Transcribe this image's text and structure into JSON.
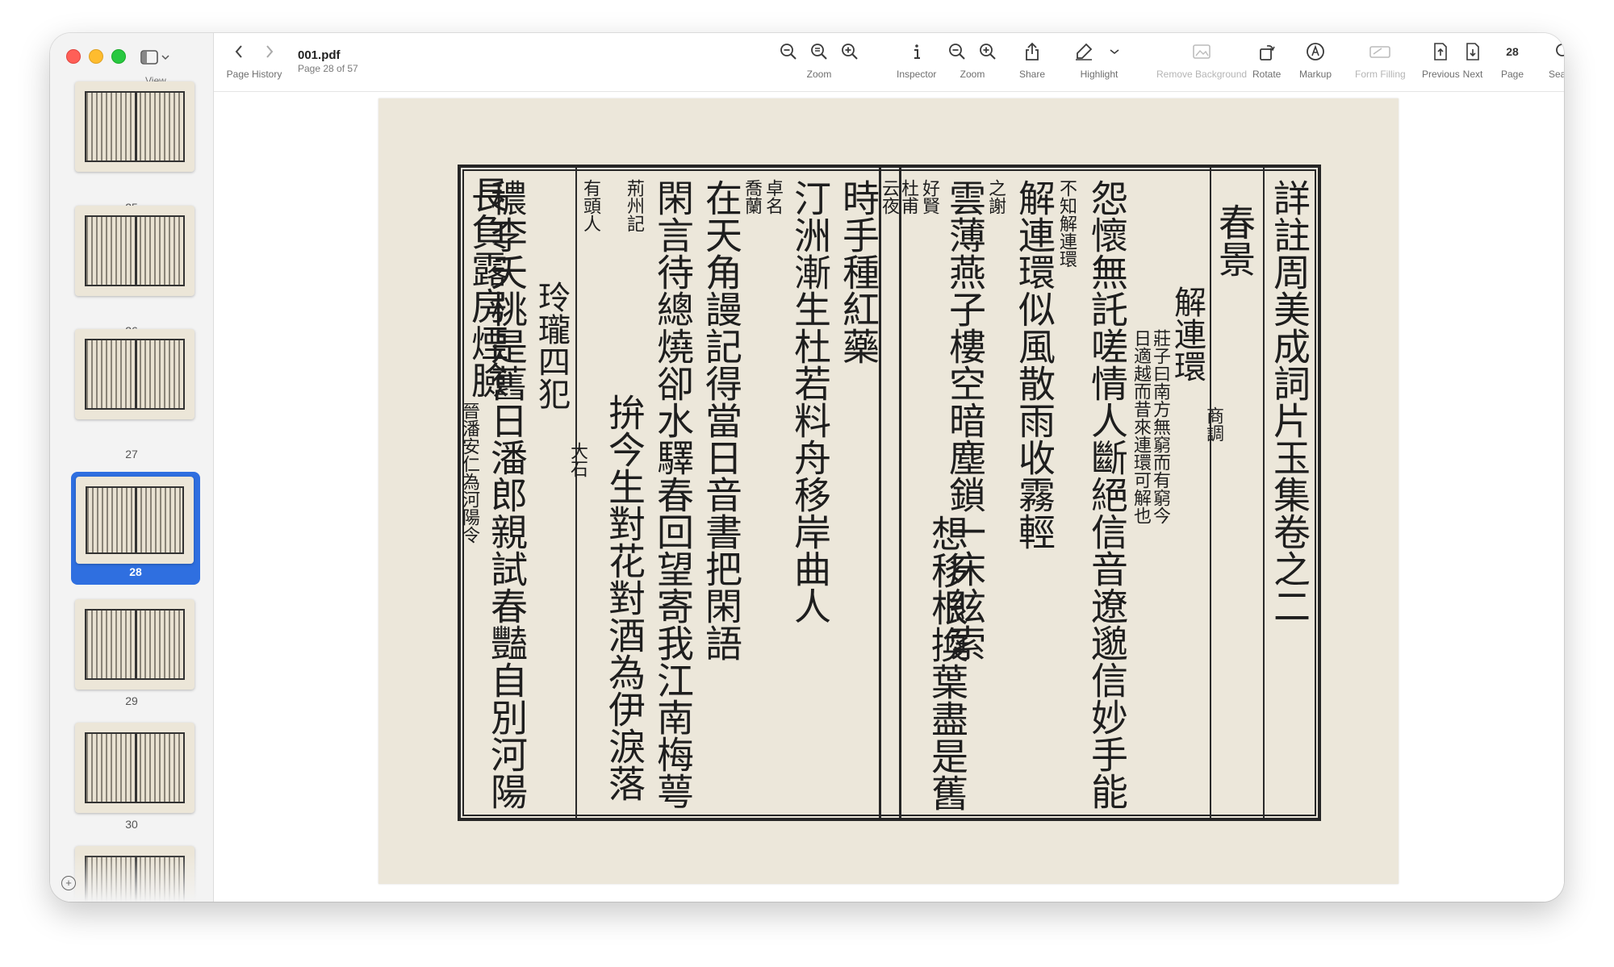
{
  "window": {
    "document_title": "001.pdf",
    "page_status": "Page 28 of 57"
  },
  "sidebar": {
    "view_label": "View",
    "pages": [
      "25",
      "26",
      "27",
      "28",
      "29",
      "30"
    ],
    "selected_page": "28"
  },
  "toolbar": {
    "page_history": "Page History",
    "zoom_label": "Zoom",
    "inspector_label": "Inspector",
    "zoom2_label": "Zoom",
    "share_label": "Share",
    "highlight_label": "Highlight",
    "remove_bg_label": "Remove Background",
    "rotate_label": "Rotate",
    "markup_label": "Markup",
    "form_filling_label": "Form Filling",
    "previous_label": "Previous",
    "next_label": "Next",
    "page_label": "Page",
    "page_value": "28",
    "search_label": "Search"
  },
  "document": {
    "title_col": "詳註周美成詞片玉集卷之二",
    "section": "春景",
    "tune": "解連環",
    "mode": "商調",
    "right_cols": [
      "怨懷無託嗟情人斷絕信音遼邈信妙手能",
      "解連環似風散雨收霧輕",
      "雲薄燕子樓空暗塵鎖一床絃索",
      "想移根換葉盡是舊"
    ],
    "left_cols": [
      "時手種紅藥",
      "汀洲漸生杜若料舟移岸曲人",
      "在天角謾記得當日音書把閑語",
      "閑言待總燒卻水驛春回望寄我江南梅萼",
      "拚今生對花對酒為伊淚落",
      "玲瓏四犯",
      "穠李夭桃是舊日潘郎親試春豔自別河陽",
      "長負露房煙臉"
    ],
    "right_notes": [
      "莊子曰南方無窮而有窮今",
      "日適越而昔來連環可解也",
      "不知解連環",
      "之謝",
      "好賢",
      "杜甫",
      "云夜"
    ],
    "left_notes": [
      "有頭人",
      "荊州記",
      "喬蘭",
      "卓名",
      "大石",
      "晉潘安仁為河陽令"
    ]
  }
}
